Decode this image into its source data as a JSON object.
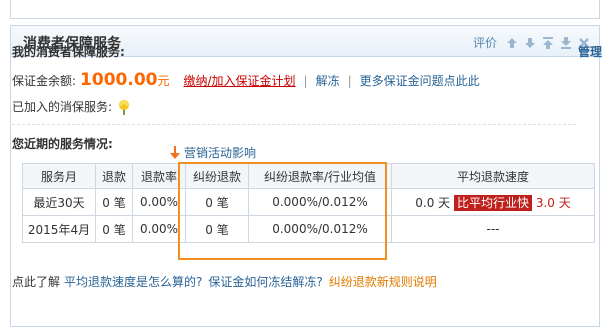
{
  "panel": {
    "title": "消费者保障服务",
    "rating_label": "评价"
  },
  "section1": {
    "title": "我的消费者保障服务:",
    "manage_label": "管理",
    "balance_label": "保证金余额:",
    "balance_amount": "1000.00",
    "balance_unit": "元",
    "pay_link": "缴纳/加入保证金计划",
    "unfreeze_link": "解冻",
    "more_link": "更多保证金问题点此此",
    "joined_label": "已加入的消保服务:"
  },
  "section2": {
    "title": "您近期的服务情况:",
    "note": "营销活动影响"
  },
  "table": {
    "headers": [
      "服务月",
      "退款",
      "退款率",
      "纠纷退款",
      "纠纷退款率/行业均值",
      "平均退款速度"
    ],
    "rows": [
      {
        "month": "最近30天",
        "refund": "0 笔",
        "refund_rate": "0.00%",
        "dispute": "0 笔",
        "dispute_rate": "0.000%/0.012%",
        "speed": "0.0 天",
        "badge": "比平均行业快",
        "speed_days": "3.0 天"
      },
      {
        "month": "2015年4月",
        "refund": "0 笔",
        "refund_rate": "0.00%",
        "dispute": "0 笔",
        "dispute_rate": "0.000%/0.012%",
        "speed": "---"
      }
    ]
  },
  "bottom": {
    "prefix": "点此了解",
    "link1": "平均退款速度是怎么算的?",
    "link2": "保证金如何冻结解冻?",
    "link3": "纠纷退款新规则说明"
  },
  "colors": {
    "accent_orange": "#f60",
    "link_blue": "#2a6496",
    "badge_red": "#c0201c",
    "highlight_border": "#f0901e"
  }
}
